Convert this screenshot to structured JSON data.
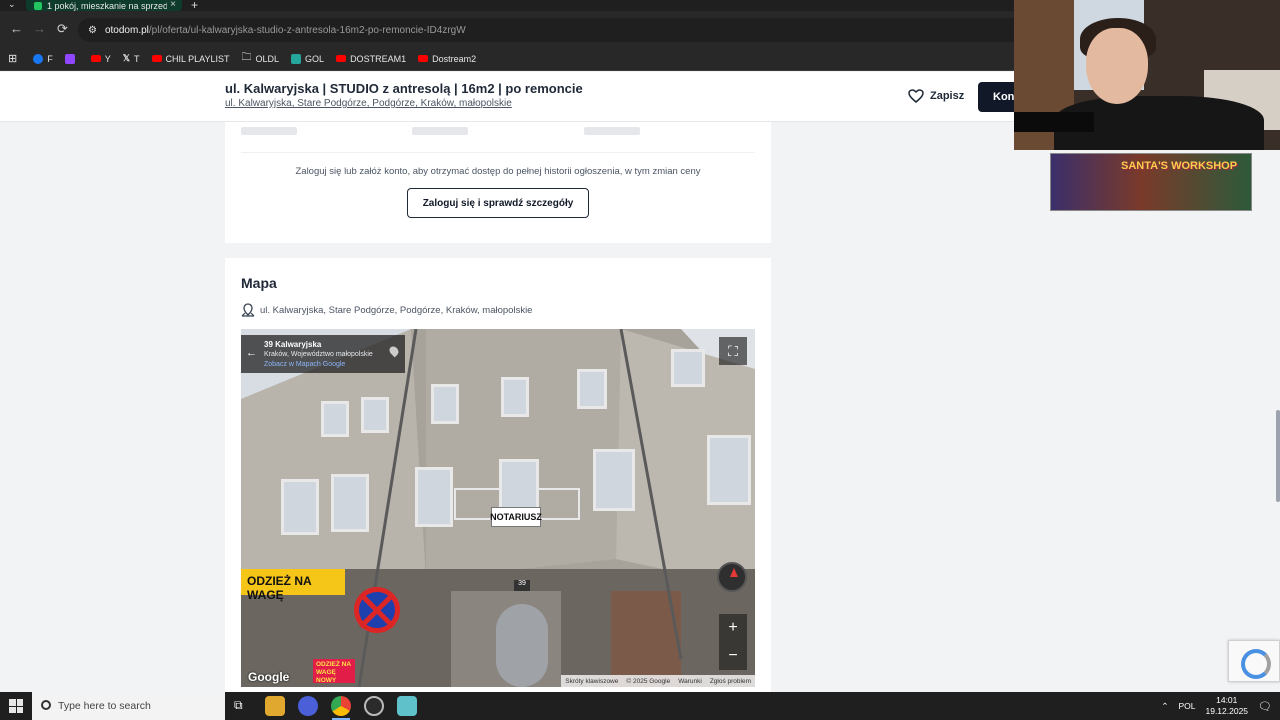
{
  "browser": {
    "tab_title": "1 pokój, mieszkanie na sprzedaż",
    "url_host": "otodom.pl",
    "url_path": "/pl/oferta/ul-kalwaryjska-studio-z-antresola-16m2-po-remoncie-ID4zrgW",
    "bookmarks": [
      {
        "label": "F",
        "color": "#1877f2"
      },
      {
        "label": "",
        "color": "#9146ff"
      },
      {
        "label": "Y",
        "color": "#ff0000"
      },
      {
        "label": "T",
        "color": "#ffffff"
      },
      {
        "label": "CHIL PLAYLIST",
        "color": "#ff0000"
      },
      {
        "label": "OLDL",
        "color": "#aaaaaa"
      },
      {
        "label": "GOL",
        "color": "#26a69a"
      },
      {
        "label": "DOSTREAM1",
        "color": "#ff0000"
      },
      {
        "label": "Dostream2",
        "color": "#ff0000"
      }
    ]
  },
  "listing": {
    "title": "ul. Kalwaryjska | STUDIO z antresolą | 16m2 | po remoncie",
    "address": "ul. Kalwaryjska, Stare Podgórze, Podgórze, Kraków, małopolskie",
    "save_label": "Zapisz",
    "contact_label": "Kon"
  },
  "history": {
    "login_note": "Zaloguj się lub załóż konto, aby otrzymać dostęp do pełnej historii ogłoszenia, w tym zmian ceny",
    "login_button": "Zaloguj się i sprawdź szczegóły"
  },
  "map": {
    "title": "Mapa",
    "address": "ul. Kalwaryjska, Stare Podgórze, Podgórze, Kraków, małopolskie",
    "streetview": {
      "place_name": "39 Kalwaryjska",
      "region": "Kraków, Województwo małopolskie",
      "open_link": "Zobacz w Mapach Google",
      "google_logo": "Google",
      "footer": [
        "Skróty klawiszowe",
        "© 2025 Google",
        "Warunki",
        "Zgłoś problem"
      ],
      "signs": {
        "shop": "ODZIEŻ NA WAGĘ",
        "notary": "NOTARIUSZ",
        "number": "39",
        "sale": "ODZIEŻ NA WAGĘ NOWY"
      }
    }
  },
  "overlay": {
    "game_title": "SANTA'S WORKSHOP"
  },
  "taskbar": {
    "search_placeholder": "Type here to search",
    "language": "POL",
    "time": "14:01",
    "date": "19.12.2025"
  }
}
